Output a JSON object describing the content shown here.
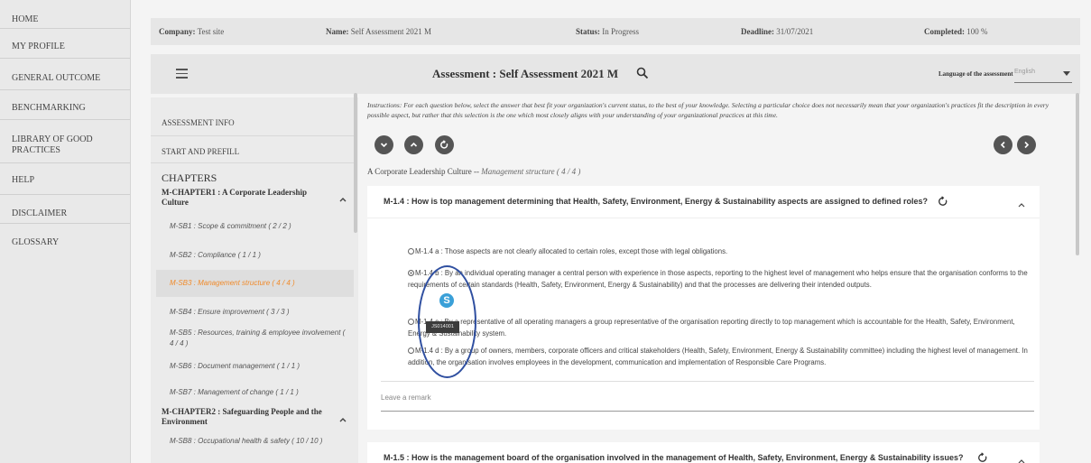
{
  "nav": {
    "items": [
      {
        "label": "HOME"
      },
      {
        "label": "MY PROFILE"
      },
      {
        "label": "GENERAL OUTCOME"
      },
      {
        "label": "BENCHMARKING"
      },
      {
        "label": "LIBRARY OF GOOD PRACTICES"
      },
      {
        "label": "HELP"
      },
      {
        "label": "DISCLAIMER"
      },
      {
        "label": "GLOSSARY"
      }
    ]
  },
  "info": {
    "company_label": "Company:",
    "company_value": "Test site",
    "name_label": "Name:",
    "name_value": "Self Assessment 2021 M",
    "status_label": "Status:",
    "status_value": "In Progress",
    "deadline_label": "Deadline:",
    "deadline_value": "31/07/2021",
    "completed_label": "Completed:",
    "completed_value": "100 %"
  },
  "header": {
    "title": "Assessment : Self Assessment 2021 M",
    "language_label": "Language of the assessment",
    "language_value": "English"
  },
  "sidebar": {
    "assessment_info": "ASSESSMENT INFO",
    "start_prefill": "START AND PREFILL",
    "chapters_heading": "CHAPTERS",
    "chapter1": "M-CHAPTER1 : A Corporate Leadership Culture",
    "chapter2": "M-CHAPTER2 : Safeguarding People and the Environment",
    "subs": [
      {
        "label": "M-SB1 : Scope & commitment ( 2 / 2 )"
      },
      {
        "label": "M-SB2 : Compliance ( 1 / 1 )"
      },
      {
        "label": "M-SB3 : Management structure ( 4 / 4 )"
      },
      {
        "label": "M-SB4 : Ensure improvement ( 3 / 3 )"
      },
      {
        "label": "M-SB5 : Resources, training & employee involvement ( 4 / 4 )"
      },
      {
        "label": "M-SB6 : Document management ( 1 / 1 )"
      },
      {
        "label": "M-SB7 : Management of change ( 1 / 1 )"
      },
      {
        "label": "M-SB8 : Occupational health & safety ( 10 / 10 )"
      }
    ]
  },
  "content": {
    "instructions": "Instructions: For each question below, select the answer that best fit your organization's current status, to the best of your knowledge. Selecting a particular choice does not necessarily mean that your organization's practices fit the description in every possible aspect, but rather that this selection is the one which most closely aligns with your understanding of your organizational practices at this time.",
    "breadcrumb_main": "A Corporate Leadership Culture -- ",
    "breadcrumb_sub": "Management structure ( 4 / 4 )",
    "q14": {
      "title": "M-1.4 : How is top management determining that Health, Safety, Environment, Energy & Sustainability aspects are assigned to defined roles?",
      "opt_a": "M-1.4 a : Those aspects are not clearly allocated to certain roles, except those with legal obligations.",
      "opt_b": "M-1.4 b : By an individual operating manager a central person with experience in those aspects, reporting to the highest level of management who helps ensure that the organisation conforms to the requirements of certain standards (Health, Safety, Environment, Energy & Sustainability) and that the processes are delivering their intended outputs.",
      "opt_c": "M-1.4 c : By a representative of all operating managers a group representative of the organisation reporting directly to top management which is accountable for the Health, Safety, Environment, Energy & Sustainability system.",
      "opt_d": "M-1.4 d : By a group of owners, members, corporate officers and critical stakeholders (Health, Safety, Environment, Energy & Sustainability committee) including the highest level of management. In addition, the organisation involves employees in the development, communication and implementation of Responsible Care Programs.",
      "selected": "b",
      "remark_placeholder": "Leave a remark"
    },
    "q15": {
      "title": "M-1.5 : How is the management board of the organisation involved in the management of Health, Safety, Environment, Energy & Sustainability issues?"
    },
    "tooltip": "JS014001",
    "badge": "S"
  }
}
